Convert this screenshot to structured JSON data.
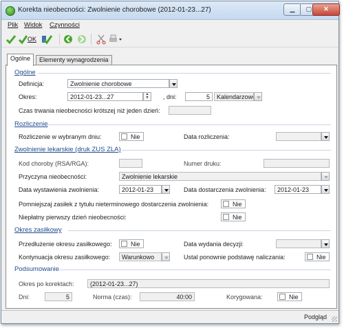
{
  "window": {
    "title": "Korekta nieobecności: Zwolnienie chorobowe (2012-01-23...27)"
  },
  "menu": [
    "Plik",
    "Widok",
    "Czynności"
  ],
  "toolbar": {
    "ok_label": "OK"
  },
  "tabs": [
    "Ogólne",
    "Elementy wynagrodzenia"
  ],
  "ogolne": {
    "header": "Ogólne",
    "definicja_label": "Definicja:",
    "definicja_value": "Zwolnienie chorobowe",
    "okres_label": "Okres:",
    "okres_value": "2012-01-23...27",
    "dni_label": ", dni:",
    "dni_value": "5",
    "typ_value": "Kalendarzowe",
    "czas_label": "Czas trwania nieobecności krótszej niż jeden dzień:"
  },
  "rozliczenie": {
    "header": "Rozliczenie",
    "w_dniu_label": "Rozliczenie w wybranym dniu:",
    "w_dniu_value": "Nie",
    "data_label": "Data rozliczenia:"
  },
  "zwolnienie": {
    "header": "Zwolnienie lekarskie (druk ZUS ZLA)",
    "kod_label": "Kod choroby (RSA/RGA):",
    "numer_label": "Numer druku:",
    "przyczyna_label": "Przyczyna nieobecności:",
    "przyczyna_value": "Zwolnienie lekarskie",
    "data_wyst_label": "Data wystawienia zwolnienia:",
    "data_wyst_value": "2012-01-23",
    "data_dost_label": "Data dostarczenia zwolnienia:",
    "data_dost_value": "2012-01-23",
    "pomniejszaj_label": "Pomniejszaj zasiłek z tytułu nieterminowego dostarczenia zwolnienia:",
    "pomniejszaj_value": "Nie",
    "nieplatny_label": "Niepłatny pierwszy dzień nieobecności:",
    "nieplatny_value": "Nie"
  },
  "okres_zasilkowy": {
    "header": "Okres zasiłkowy",
    "przedluzenie_label": "Przedłużenie okresu zasiłkowego:",
    "przedluzenie_value": "Nie",
    "data_decyzji_label": "Data wydania decyzji:",
    "kontynuacja_label": "Kontynuacja okresu zasiłkowego:",
    "kontynuacja_value": "Warunkowo",
    "ustal_label": "Ustal ponownie podstawę naliczania:",
    "ustal_value": "Nie"
  },
  "podsumowanie": {
    "header": "Podsumowanie",
    "okres_label": "Okres po korektach:",
    "okres_value": "(2012-01-23...27)",
    "dni_label": "Dni:",
    "dni_value": "5",
    "norma_label": "Norma (czas):",
    "norma_value": "40:00",
    "korygowana_label": "Korygowana:",
    "korygowana_value": "Nie"
  },
  "status": {
    "preview": "Podgląd"
  }
}
